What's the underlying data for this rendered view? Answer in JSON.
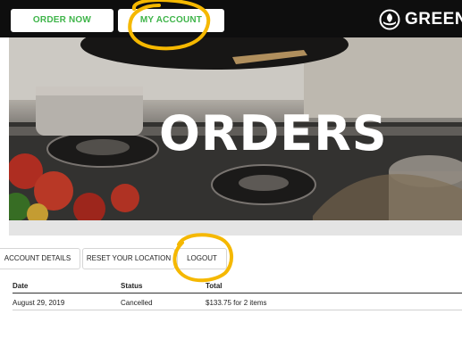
{
  "header": {
    "order_now_label": "ORDER NOW",
    "my_account_label": "MY ACCOUNT",
    "brand_name": "GREEN",
    "brand_icon": "leaf-hand-logo"
  },
  "hero": {
    "title": "ORDERS"
  },
  "account_tabs": [
    {
      "label": "ACCOUNT DETAILS"
    },
    {
      "label": "RESET YOUR LOCATION"
    },
    {
      "label": "LOGOUT"
    }
  ],
  "orders_table": {
    "columns": [
      "Date",
      "Status",
      "Total"
    ],
    "rows": [
      {
        "date": "August 29, 2019",
        "status": "Cancelled",
        "total": "$133.75 for 2 items"
      }
    ]
  },
  "colors": {
    "brand_green": "#3fb54a",
    "topbar": "#0e0e0e",
    "annotation_yellow": "#f5b800"
  }
}
